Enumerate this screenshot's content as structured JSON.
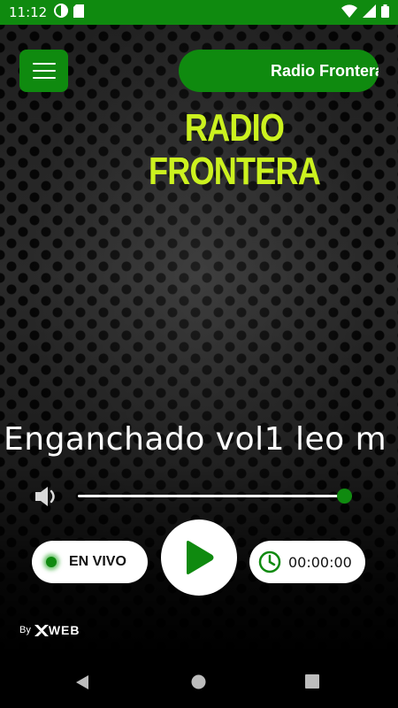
{
  "status_bar": {
    "time": "11:12"
  },
  "header": {
    "station_name": "Radio Frontera"
  },
  "logo": {
    "line1": "RADIO",
    "line2": "FRONTERA",
    "color": "#ccf21f"
  },
  "now_playing": {
    "title": "Enganchado vol1 leo m"
  },
  "controls": {
    "live_label": "EN VIVO",
    "timer": "00:00:00",
    "volume_level": 1.0
  },
  "credit": {
    "by": "By",
    "brand": "WEB"
  },
  "colors": {
    "accent": "#0f8a0f",
    "logo": "#ccf21f"
  },
  "icons": {
    "menu": "hamburger-icon",
    "volume": "speaker-icon",
    "play": "play-icon",
    "clock": "clock-icon"
  }
}
